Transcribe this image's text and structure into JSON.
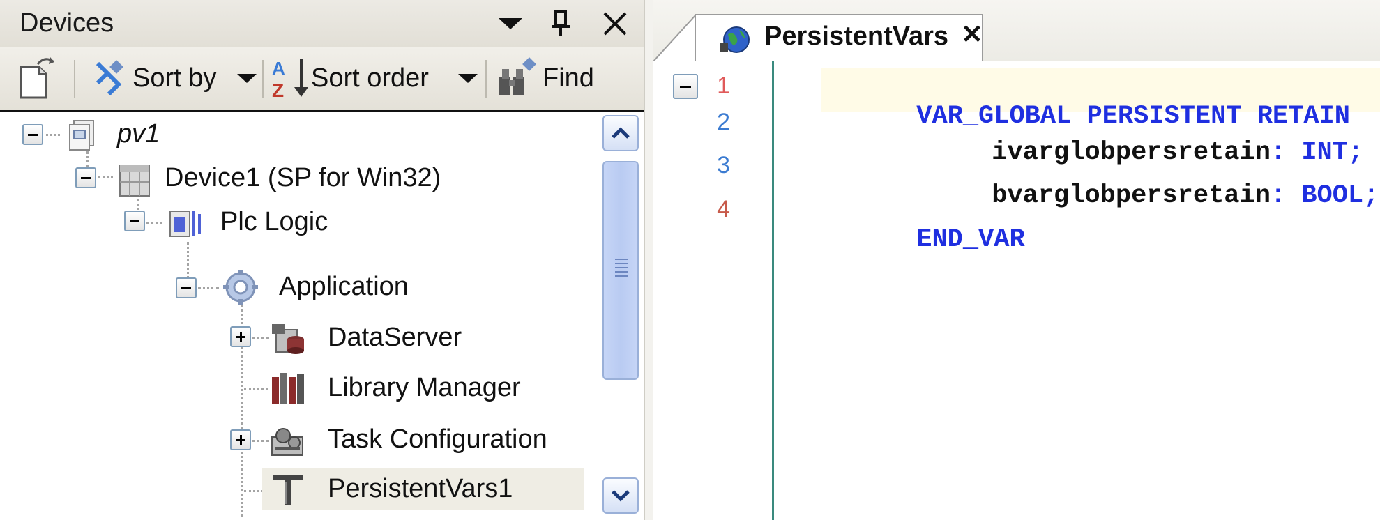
{
  "devices_panel": {
    "title": "Devices",
    "toolbar": {
      "sort_by_label": "Sort by",
      "sort_order_label": "Sort order",
      "find_label": "Find"
    },
    "tree": [
      {
        "label": "pv1",
        "expanded": true
      },
      {
        "label": "Device1 (SP for Win32)",
        "expanded": true
      },
      {
        "label": "Plc Logic",
        "expanded": true
      },
      {
        "label": "Application",
        "expanded": true
      },
      {
        "label": "DataServer",
        "expanded": false
      },
      {
        "label": "Library Manager"
      },
      {
        "label": "Task Configuration",
        "expanded": false
      },
      {
        "label": "PersistentVars1",
        "selected": true
      }
    ]
  },
  "editor": {
    "tab_title": "PersistentVars",
    "line_numbers": [
      "1",
      "2",
      "3",
      "4"
    ],
    "lines": [
      {
        "tokens": [
          {
            "text": "VAR_GLOBAL PERSISTENT RETAIN",
            "kind": "keyword"
          }
        ]
      },
      {
        "tokens": [
          {
            "text": "ivarglobpersretain",
            "kind": "identifier"
          },
          {
            "text": ": INT;",
            "kind": "keyword"
          }
        ]
      },
      {
        "tokens": [
          {
            "text": "bvarglobpersretain",
            "kind": "identifier"
          },
          {
            "text": ": BOOL;",
            "kind": "keyword"
          }
        ]
      },
      {
        "tokens": [
          {
            "text": "END_VAR",
            "kind": "keyword"
          }
        ]
      }
    ]
  },
  "colors": {
    "keyword": "#1f2fe0",
    "line_number_odd": "#e05a5a",
    "line_number_even": "#3b7bd1",
    "gutter_line": "#3a8a7e",
    "current_line_highlight": "#fffbe7",
    "selected_row": "#efede4"
  }
}
